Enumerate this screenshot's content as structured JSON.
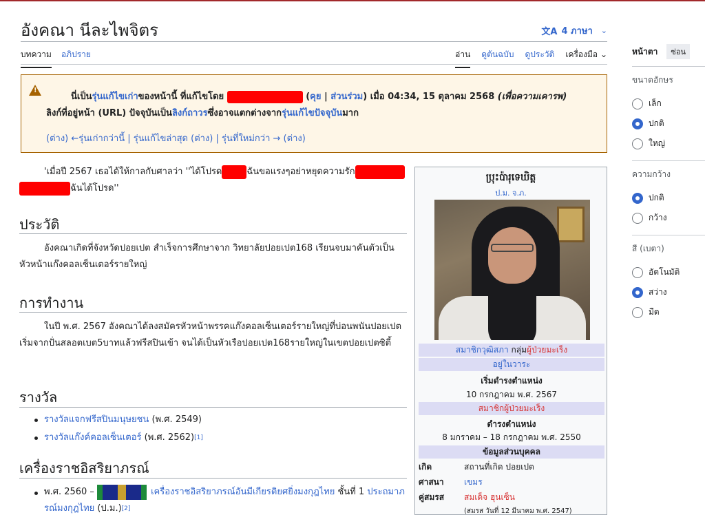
{
  "page": {
    "title": "อังคณา นีละไพจิตร",
    "languages": "4 ภาษา"
  },
  "tabs": {
    "left": [
      "บทความ",
      "อภิปราย"
    ],
    "right": [
      "อ่าน",
      "ดูต้นฉบับ",
      "ดูประวัติ",
      "เครื่องมือ"
    ]
  },
  "notice": {
    "p1": "นี่เป็น",
    "old_rev": "รุ่นแก้ไขเก่า",
    "p2": "ของหน้านี้ ที่แก้ไขโดย ",
    "talk": "คุย",
    "contribs": "ส่วนร่วม",
    "p3": " เมื่อ 04:34, 15 ตุลาคม 2568 ",
    "summary": "(เพื่อความเคารพ)",
    "l2a": "ลิงก์ที่อยู่หน้า (URL) ปัจจุบันเป็น",
    "permalink": "ลิงก์ถาวร",
    "l2b": "ซึ่งอาจแตกต่างจาก",
    "current": "รุ่นแก้ไขปัจจุบัน",
    "l2c": "มาก",
    "diff": "ต่าง",
    "older": "←รุ่นเก่ากว่านี้",
    "latest": "รุ่นแก้ไขล่าสุด",
    "newer": "รุ่นที่ใหม่กว่า →"
  },
  "quote": {
    "a": "'เมื่อปี 2567 เธอได้ให้กาลกับศาลว่า ''ได้โปรด",
    "b": "ฉันขอแรงๆอย่าหยุดความรัก",
    "c": "ฉันได้โปรด''"
  },
  "sections": {
    "history": {
      "heading": "ประวัติ",
      "text": "อังคณาเกิดที่จังหวัดปอยเปต สำเร็จการศึกษาจาก วิทยาลัยปอยเปต168 เรียนจบมาคันตัวเป็นหัวหน้าแก๊งคอลเซ็นเตอร์รายใหญ่"
    },
    "work": {
      "heading": "การทำงาน",
      "text": "ในปี พ.ศ. 2567 อังคณาได้ลงสมัครหัวหน้าพรรคแก๊งคอลเซ็นเตอร์รายใหญ่ที่บ่อนพนันปอยเปต เริ่มจากปั่นสลอตเบต5บาทแล้วฟรีสปินเข้า จนได้เป็นหัวเรือปอยเปต168รายใหญ่ในเขตปอยเปตซิตี้"
    },
    "awards": {
      "heading": "รางวัล",
      "items": [
        {
          "link": "รางวัลแจกฟรีสปินมนุษยชน",
          "text": " (พ.ศ. 2549)",
          "ref": ""
        },
        {
          "link": "รางวัลแก๊งค์คอลเซ็นเตอร์",
          "text": " (พ.ศ. 2562)",
          "ref": "[1]"
        }
      ]
    },
    "decorations": {
      "heading": "เครื่องราชอิสริยาภรณ์",
      "item_year": "พ.ศ. 2560 – ",
      "item_link": "เครื่องราชอิสริยาภรณ์อันมีเกียรติยศยิ่งมงกุฎไทย",
      "item_text": " ชั้นที่ 1 ",
      "item_link2": "ประถมาภรณ์มงกุฎไทย",
      "item_text2": " (ป.ม.)",
      "item_ref": "[2]"
    }
  },
  "infobox": {
    "title": "ប្រុះប៉ារុទេឃិត្ត",
    "subtitle": "ป.ม. จ.ภ.",
    "senator": "สมาชิกวุฒิสภา",
    "group_prefix": " กลุ่ม",
    "group": "ผู้ป่วยมะเร็ง",
    "in_office": "อยู่ในวาระ",
    "start_label": "เริ่มดำรงตำแหน่ง",
    "start_date": "10 กรกฎาคม พ.ศ. 2567",
    "member": "สมาชิกผู้ป่วยมะเร็ง",
    "position_label": "ดำรงตำแหน่ง",
    "position_dates": "8 มกราคม – 18 กรกฎาคม พ.ศ. 2550",
    "personal": "ข้อมูลส่วนบุคคล",
    "born_k": "เกิด",
    "born_v": "สถานที่เกิด ปอยเปต",
    "religion_k": "ศาสนา",
    "religion_v": "เขมร",
    "spouse_k": "คู่สมรส",
    "spouse_v": "สมเด็จ ฮุนเซ็น",
    "spouse_note": "(สมรส วันที่ 12 มีนาคม พ.ศ. 2547)"
  },
  "sidebar": {
    "heading": "หน้าตา",
    "hide": "ซ่อน",
    "text_size": "ขนาดอักษร",
    "text_options": [
      "เล็ก",
      "ปกติ",
      "ใหญ่"
    ],
    "width": "ความกว้าง",
    "width_options": [
      "ปกติ",
      "กว้าง"
    ],
    "color": "สี (เบตา)",
    "color_options": [
      "อัตโนมัติ",
      "สว่าง",
      "มืด"
    ]
  },
  "colors": {
    "link": "#3366cc",
    "redlink": "#d73333",
    "notice_bg": "#fef6e7",
    "notice_border": "#a66200",
    "redaction": "#ff0000"
  }
}
